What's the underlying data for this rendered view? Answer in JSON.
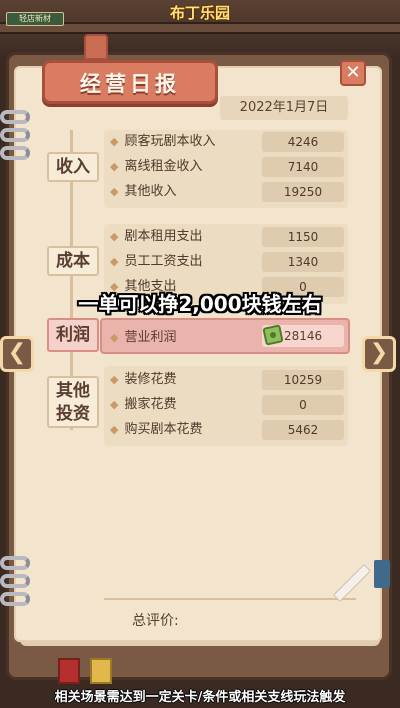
{
  "game_title": "布丁乐园",
  "mini_sign": "轻店新材",
  "ledger": {
    "title": "经营日报",
    "date": "2022年1月7日",
    "close_symbol": "✕"
  },
  "income": {
    "label": "收入",
    "items": [
      {
        "name": "顾客玩剧本收入",
        "value": "4246"
      },
      {
        "name": "离线租金收入",
        "value": "7140"
      },
      {
        "name": "其他收入",
        "value": "19250"
      }
    ]
  },
  "cost": {
    "label": "成本",
    "items": [
      {
        "name": "剧本租用支出",
        "value": "1150"
      },
      {
        "name": "员工工资支出",
        "value": "1340"
      },
      {
        "name": "其他支出",
        "value": "0"
      }
    ]
  },
  "profit": {
    "label": "利润",
    "item": {
      "name": "营业利润",
      "value": "28146"
    },
    "icon": "money-icon"
  },
  "invest": {
    "label_line1": "其他",
    "label_line2": "投资",
    "items": [
      {
        "name": "装修花费",
        "value": "10259"
      },
      {
        "name": "搬家花费",
        "value": "0"
      },
      {
        "name": "购买剧本花费",
        "value": "5462"
      }
    ]
  },
  "evaluation_label": "总评价:",
  "nav": {
    "prev": "❮",
    "next": "❯"
  },
  "caption": "一单可以挣2,000块钱左右",
  "footer_note": "相关场景需达到一定关卡/条件或相关支线玩法触发",
  "diamond": "◆"
}
